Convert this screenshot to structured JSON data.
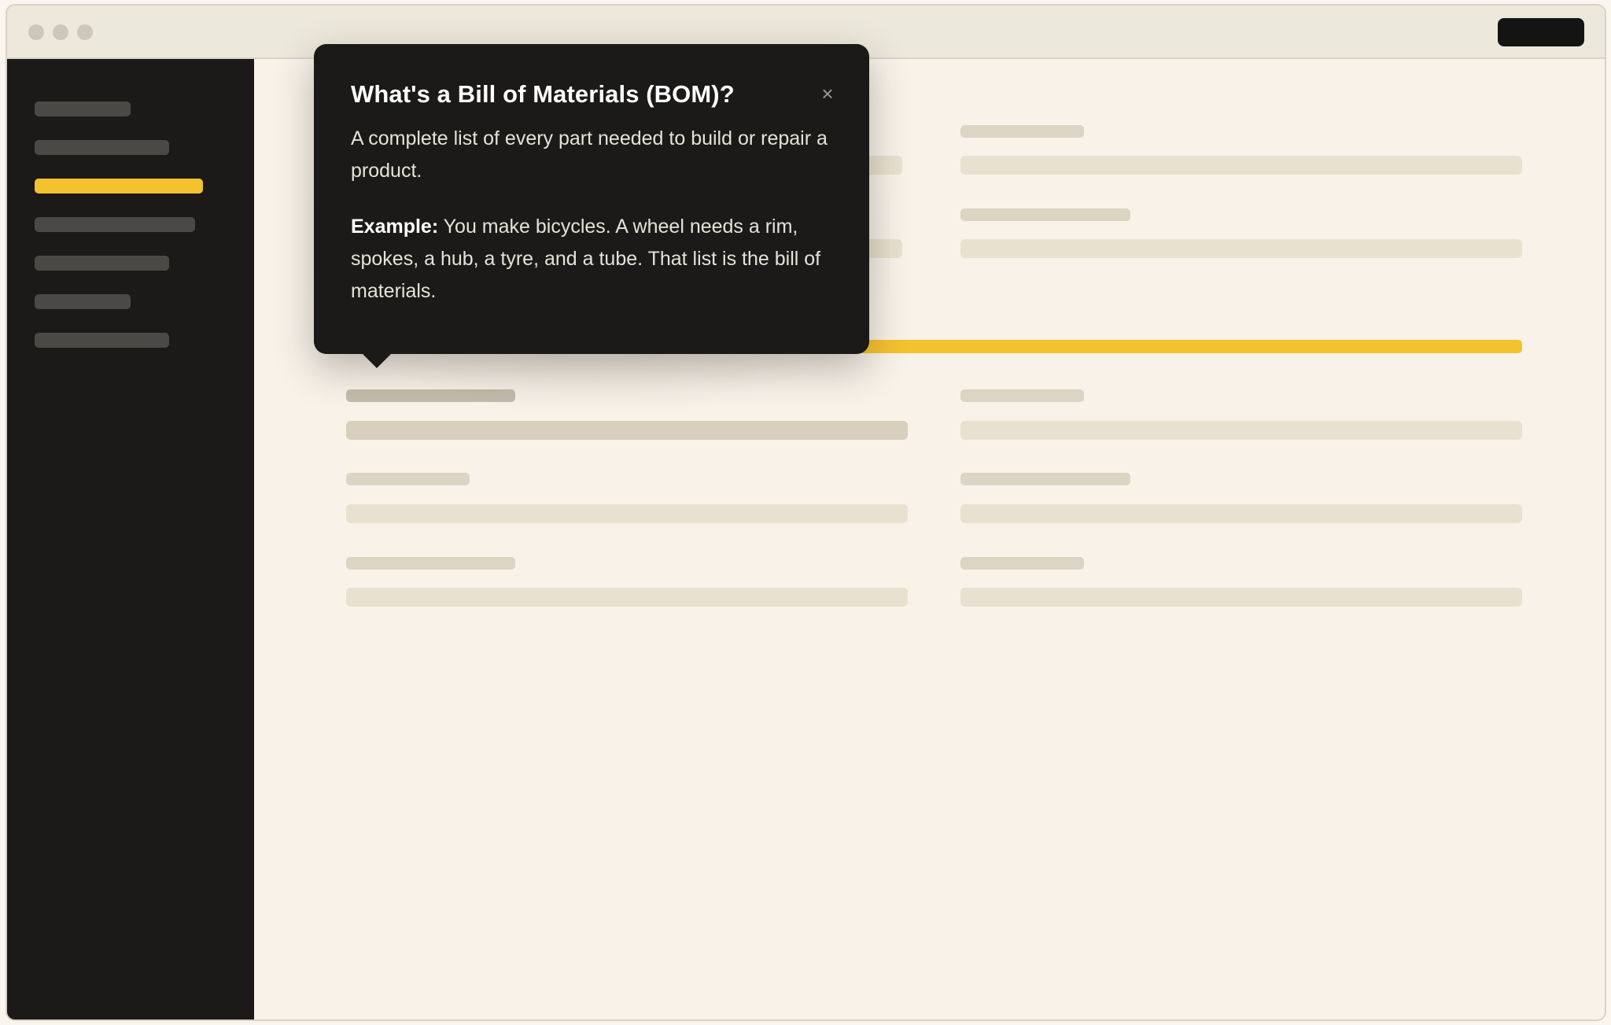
{
  "colors": {
    "accent": "#f5c22f",
    "sidebar_background": "#1b1a18",
    "content_background": "#f8f2e9",
    "popover_background": "#1b1a18"
  },
  "sidebar": {
    "active_index": 2,
    "item_count": 7
  },
  "form": {
    "progress": 1.0
  },
  "popover": {
    "title": "What's a Bill of Materials (BOM)?",
    "close_icon": "×",
    "body": "A complete list of every part needed to build or repair a product.",
    "example_label": "Example:",
    "example_text": " You make bicycles. A wheel needs a rim, spokes, a hub, a tyre, and a tube. That list is the bill of materials."
  }
}
